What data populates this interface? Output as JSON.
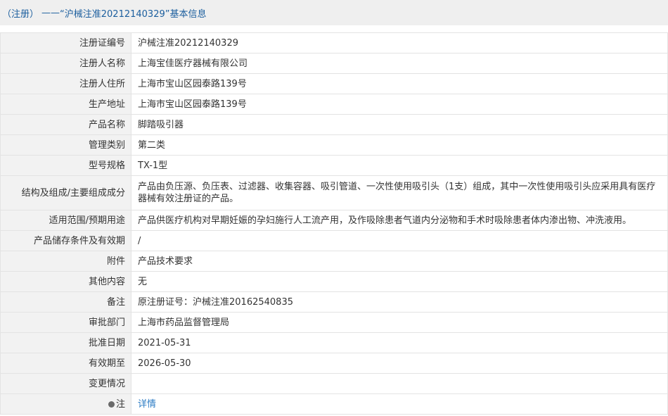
{
  "header": {
    "prefix": "（注册）",
    "dash": "——",
    "title": "“沪械注准20212140329”基本信息"
  },
  "rows": [
    {
      "label": "注册证编号",
      "value": "沪械注准20212140329"
    },
    {
      "label": "注册人名称",
      "value": "上海宝佳医疗器械有限公司"
    },
    {
      "label": "注册人住所",
      "value": "上海市宝山区园泰路139号"
    },
    {
      "label": "生产地址",
      "value": "上海市宝山区园泰路139号"
    },
    {
      "label": "产品名称",
      "value": "脚踏吸引器"
    },
    {
      "label": "管理类别",
      "value": "第二类"
    },
    {
      "label": "型号规格",
      "value": "TX-1型"
    },
    {
      "label": "结构及组成/主要组成成分",
      "value": "产品由负压源、负压表、过滤器、收集容器、吸引管道、一次性使用吸引头（1支）组成，其中一次性使用吸引头应采用具有医疗器械有效注册证的产品。"
    },
    {
      "label": "适用范围/预期用途",
      "value": "产品供医疗机构对早期妊娠的孕妇施行人工流产用，及作吸除患者气道内分泌物和手术时吸除患者体内渗出物、冲洗液用。"
    },
    {
      "label": "产品储存条件及有效期",
      "value": "/"
    },
    {
      "label": "附件",
      "value": "产品技术要求"
    },
    {
      "label": "其他内容",
      "value": "无"
    },
    {
      "label": "备注",
      "value": "原注册证号：沪械注准20162540835"
    },
    {
      "label": "审批部门",
      "value": "上海市药品监督管理局"
    },
    {
      "label": "批准日期",
      "value": "2021-05-31"
    },
    {
      "label": "有效期至",
      "value": "2026-05-30"
    },
    {
      "label": "变更情况",
      "value": ""
    }
  ],
  "note_row": {
    "label": "注",
    "icon": "pin-icon",
    "link_text": "详情",
    "link_color": "#2c7cc4"
  }
}
